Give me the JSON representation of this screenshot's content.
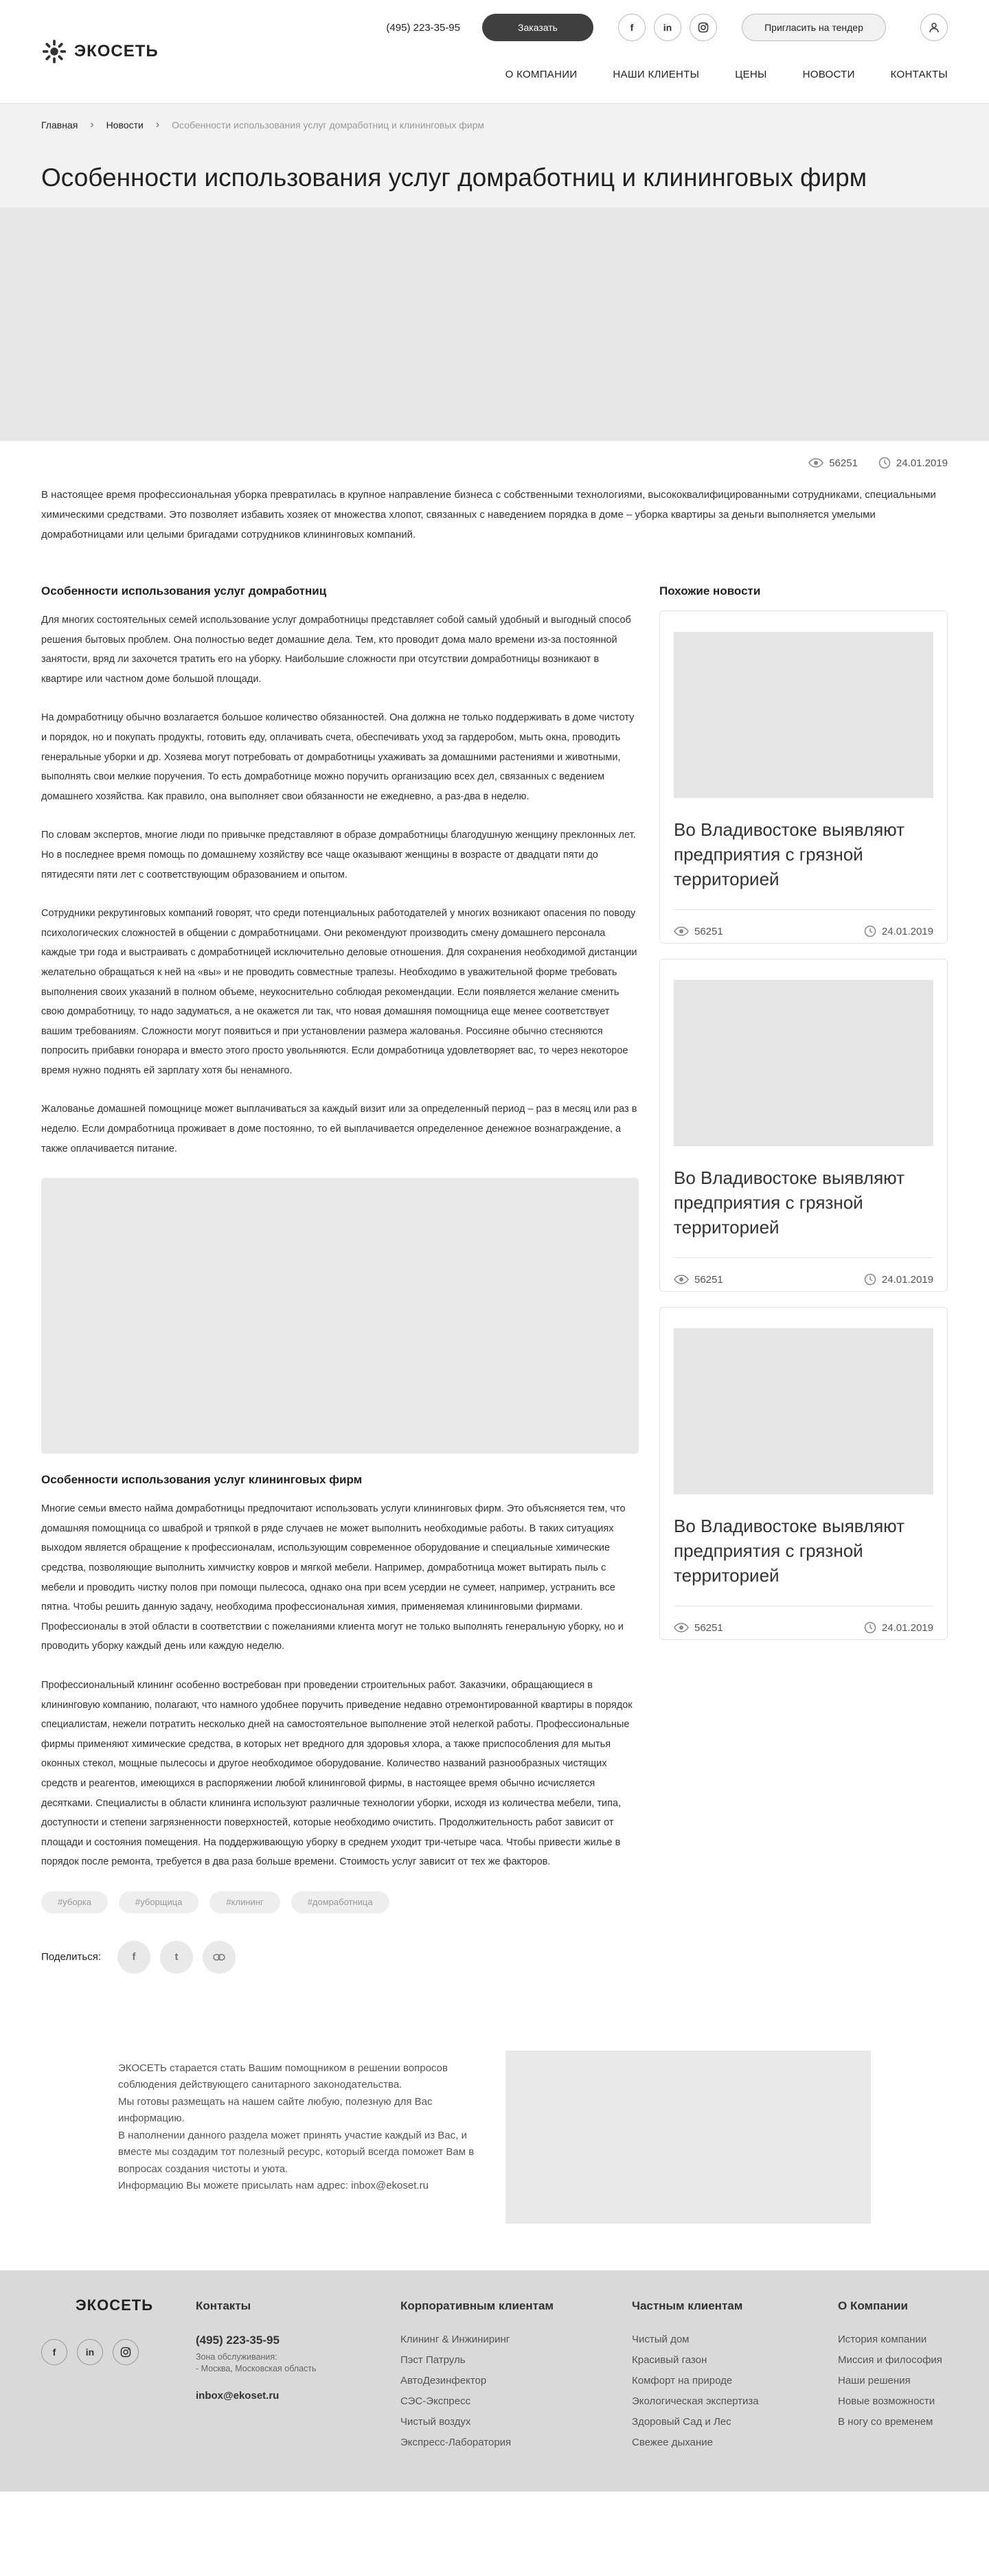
{
  "header": {
    "brand": "ЭКОСЕТЬ",
    "phone": "(495) 223-35-95",
    "order_btn": "Заказать",
    "tender_btn": "Пригласить на тендер",
    "social": [
      "f",
      "in",
      "ig"
    ],
    "nav": [
      "О КОМПАНИИ",
      "НАШИ КЛИЕНТЫ",
      "ЦЕНЫ",
      "НОВОСТИ",
      "КОНТАКТЫ"
    ]
  },
  "breadcrumb": {
    "home": "Главная",
    "news": "Новости",
    "current": "Особенности использования услуг домработниц и клининговых фирм"
  },
  "title": "Особенности использования услуг домработниц и клининговых фирм",
  "meta": {
    "views": "56251",
    "date": "24.01.2019"
  },
  "lead": "В настоящее время профессиональная уборка превратилась в крупное направление бизнеса с собственными технологиями, высококвалифицированными сотрудниками, специальными химическими средствами. Это позволяет избавить хозяек от множества хлопот, связанных с наведением порядка в доме – уборка квартиры за деньги выполняется умелыми домработницами или целыми бригадами сотрудников клининговых компаний.",
  "article": {
    "h1": "Особенности использования услуг домработниц",
    "p1": "Для многих состоятельных семей использование услуг домработницы представляет собой самый удобный и выгодный способ решения бытовых проблем. Она полностью ведет домашние дела. Тем, кто проводит дома мало времени из-за постоянной занятости, вряд ли захочется тратить его на уборку. Наибольшие сложности при отсутствии домработницы возникают в квартире или частном доме большой площади.",
    "p2": "На домработницу обычно возлагается большое количество обязанностей. Она должна не только поддерживать в доме чистоту и порядок, но и покупать продукты, готовить еду, оплачивать счета, обеспечивать уход за гардеробом, мыть окна, проводить генеральные уборки и др. Хозяева могут потребовать от домработницы ухаживать за домашними растениями и животными, выполнять свои мелкие поручения. То есть домработнице можно поручить организацию всех дел, связанных с ведением домашнего хозяйства. Как правило, она выполняет свои обязанности не ежедневно, а раз-два в неделю.",
    "p3": "По словам экспертов, многие люди по привычке представляют в образе домработницы благодушную женщину преклонных лет. Но в последнее время помощь по домашнему хозяйству все чаще оказывают женщины в возрасте от двадцати пяти до пятидесяти пяти лет с соответствующим образованием и опытом.",
    "p4": "Сотрудники рекрутинговых компаний говорят, что среди потенциальных работодателей у многих возникают опасения по поводу психологических сложностей в общении с домработницами. Они рекомендуют производить смену домашнего персонала каждые три года и выстраивать с домработницей исключительно деловые отношения. Для сохранения необходимой дистанции желательно обращаться к ней на «вы» и не проводить совместные трапезы. Необходимо в уважительной форме требовать выполнения своих указаний в полном объеме, неукоснительно соблюдая рекомендации. Если появляется желание сменить свою домработницу, то надо задуматься, а не окажется ли так, что новая домашняя помощница еще менее соответствует вашим требованиям. Сложности могут появиться и при установлении размера жалованья. Россияне обычно стесняются попросить прибавки гонорара и вместо этого просто увольняются. Если домработница удовлетворяет вас, то через некоторое время нужно поднять ей зарплату хотя бы ненамного.",
    "p5": "Жалованье домашней помощнице может выплачиваться за каждый визит или за определенный период – раз в месяц или раз в неделю. Если домработница проживает в доме постоянно, то ей выплачивается определенное денежное вознаграждение, а также оплачивается питание.",
    "h2": "Особенности использования услуг клининговых фирм",
    "p6": "Многие семьи вместо найма домработницы предпочитают использовать услуги клининговых фирм. Это объясняется тем, что домашняя помощница со шваброй и тряпкой в ряде случаев не может выполнить необходимые работы. В таких ситуациях выходом является обращение к профессионалам, использующим современное оборудование и специальные химические средства, позволяющие выполнить химчистку ковров и мягкой мебели. Например, домработница может вытирать пыль с мебели и проводить чистку полов при помощи пылесоса, однако она при всем усердии не сумеет, например, устранить все пятна. Чтобы решить данную задачу, необходима профессиональная химия, применяемая клининговыми фирмами. Профессионалы в этой области в соответствии с пожеланиями клиента могут не только выполнять генеральную уборку, но и проводить уборку каждый день или каждую неделю.",
    "p7": "Профессиональный клининг особенно востребован при проведении строительных работ. Заказчики, обращающиеся в клининговую компанию, полагают, что намного удобнее поручить приведение недавно отремонтированной квартиры в порядок специалистам, нежели потратить несколько дней на самостоятельное выполнение этой нелегкой работы. Профессиональные фирмы применяют химические средства, в которых нет вредного для здоровья хлора, а также приспособления для мытья оконных стекол, мощные пылесосы и другое необходимое оборудование. Количество названий разнообразных чистящих средств и реагентов, имеющихся в распоряжении любой клининговой фирмы, в настоящее время обычно исчисляется десятками. Специалисты в области клининга используют различные технологии уборки, исходя из количества мебели, типа, доступности и степени загрязненности поверхностей, которые необходимо очистить. Продолжительность работ зависит от площади и состояния помещения. На поддерживающую уборку в среднем уходит три-четыре часа. Чтобы привести жилье в порядок после ремонта, требуется в два раза больше времени. Стоимость услуг зависит от тех же факторов."
  },
  "tags": [
    "#уборка",
    "#уборщица",
    "#клининг",
    "#домработница"
  ],
  "share": {
    "label": "Поделиться:",
    "buttons": [
      "f",
      "t",
      "link"
    ]
  },
  "sidebar": {
    "title": "Похожие новости",
    "cards": [
      {
        "title": "Во Владивостоке выявляют предприятия с грязной территорией",
        "views": "56251",
        "date": "24.01.2019"
      },
      {
        "title": "Во Владивостоке выявляют предприятия с грязной территорией",
        "views": "56251",
        "date": "24.01.2019"
      },
      {
        "title": "Во Владивостоке выявляют предприятия с грязной территорией",
        "views": "56251",
        "date": "24.01.2019"
      }
    ]
  },
  "info": {
    "l1": "ЭКОСЕТЬ старается стать Вашим помощником в решении вопросов соблюдения действующего санитарного законодательства.",
    "l2": "Мы готовы размещать на нашем сайте любую, полезную для Вас информацию.",
    "l3": "В наполнении данного раздела может принять участие каждый из Вас, и вместе мы создадим тот полезный ресурс, который всегда поможет Вам в вопросах создания чистоты и уюта.",
    "l4": "Информацию Вы можете присылать нам адрес: inbox@ekoset.ru"
  },
  "footer": {
    "brand": "ЭКОСЕТЬ",
    "contacts": {
      "title": "Контакты",
      "phone": "(495) 223-35-95",
      "zone_label": "Зона обслуживания:",
      "zone_value": "- Москва, Московская область",
      "email": "inbox@ekoset.ru"
    },
    "corp": {
      "title": "Корпоративным клиентам",
      "items": [
        "Клининг & Инжиниринг",
        "Пэст Патруль",
        "АвтоДезинфектор",
        "СЭС-Экспресс",
        "Чистый воздух",
        "Экспресс-Лаборатория"
      ]
    },
    "private": {
      "title": "Частным клиентам",
      "items": [
        "Чистый дом",
        "Красивый газон",
        "Комфорт на природе",
        "Экологическая экспертиза",
        "Здоровый Сад и Лес",
        "Свежее дыхание"
      ]
    },
    "about": {
      "title": "О Компании",
      "items": [
        "История компании",
        "Миссия и философия",
        "Наши решения",
        "Новые возможности",
        "В ногу со временем"
      ]
    }
  }
}
